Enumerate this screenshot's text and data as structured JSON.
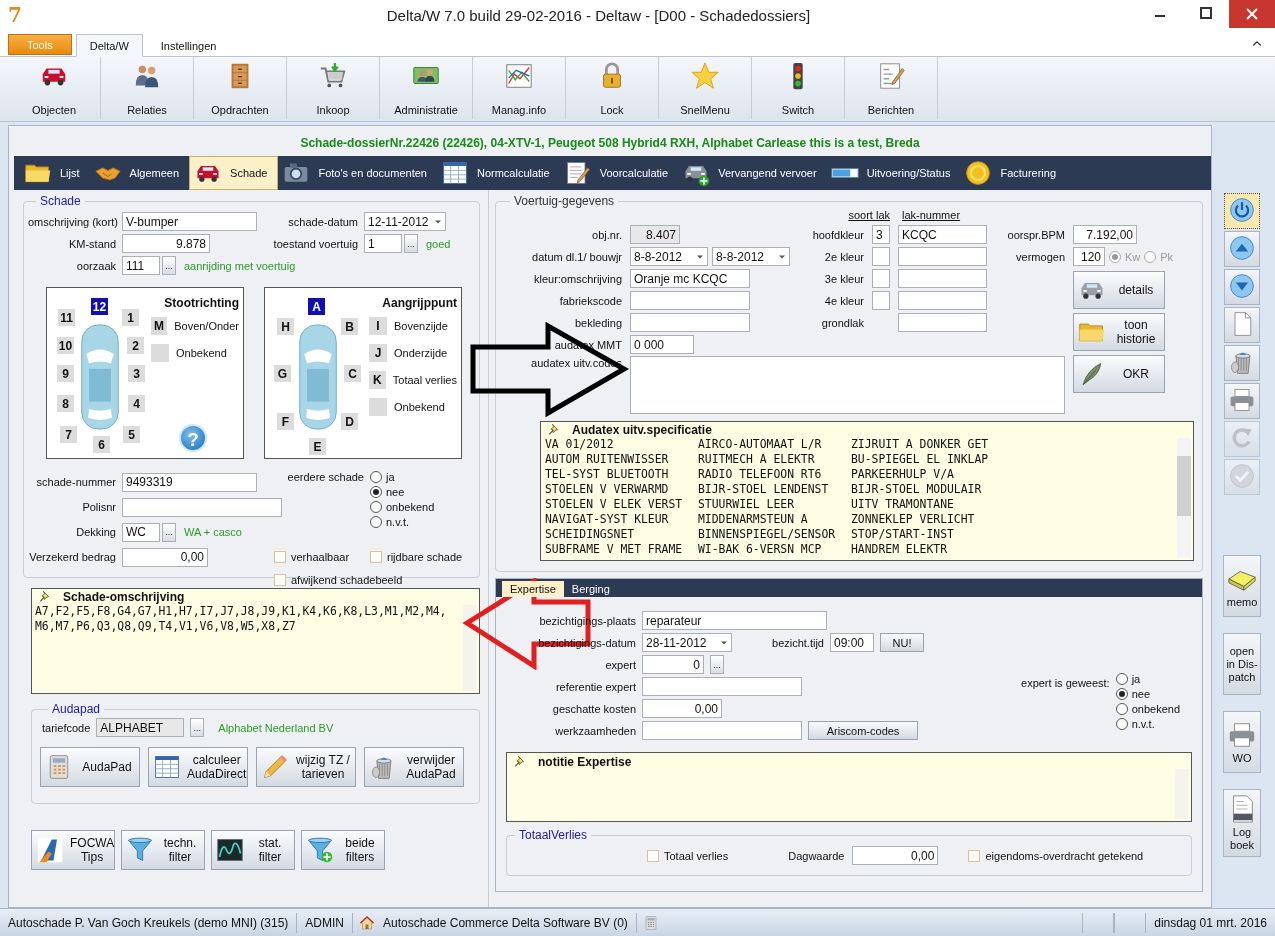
{
  "window": {
    "app_icon": "7",
    "title": "Delta/W 7.0 build 29-02-2016 - Deltaw - [D00 - Schadedossiers]"
  },
  "ribbon_tabs": [
    {
      "label": "Tools",
      "kind": "menu",
      "selected": false
    },
    {
      "label": "Delta/W",
      "kind": "tab",
      "selected": true
    },
    {
      "label": "Instellingen",
      "kind": "tab",
      "selected": false
    }
  ],
  "ribbon": [
    "Objecten",
    "Relaties",
    "Opdrachten",
    "Inkoop",
    "Administratie",
    "Manag.info",
    "Lock",
    "SnelMenu",
    "Switch",
    "Berichten"
  ],
  "dossier_header": "Schade-dossierNr.22426 (22426), 04-XTV-1, Peugeot 508 Hybrid4 RXH, Alphabet Carlease this is a test, Breda",
  "tabs": [
    {
      "label": "Lijst",
      "selected": false
    },
    {
      "label": "Algemeen",
      "selected": false
    },
    {
      "label": "Schade",
      "selected": true
    },
    {
      "label": "Foto's en documenten",
      "selected": false
    },
    {
      "label": "Normcalculatie",
      "selected": false
    },
    {
      "label": "Voorcalculatie",
      "selected": false
    },
    {
      "label": "Vervangend vervoer",
      "selected": false
    },
    {
      "label": "Uitvoering/Status",
      "selected": false
    },
    {
      "label": "Facturering",
      "selected": false
    }
  ],
  "schade": {
    "title": "Schade",
    "omschrijving": {
      "label": "omschrijving (kort)",
      "value": "V-bumper"
    },
    "schade_datum": {
      "label": "schade-datum",
      "value": "12-11-2012"
    },
    "km_stand": {
      "label": "KM-stand",
      "value": "9.878"
    },
    "toestand": {
      "label": "toestand voertuig",
      "value": "1",
      "browse_button": "...",
      "description": "goed"
    },
    "oorzaak": {
      "label": "oorzaak",
      "value": "111",
      "browse_button": "...",
      "description": "aanrijding met voertuig"
    },
    "stootrichting": {
      "title": "Stootrichting",
      "help_icon": "?",
      "positions": [
        {
          "label": "12",
          "selected": true
        },
        {
          "label": "11",
          "selected": false
        },
        {
          "label": "1",
          "selected": false
        },
        {
          "label": "10",
          "selected": false
        },
        {
          "label": "2",
          "selected": false
        },
        {
          "label": "9",
          "selected": false
        },
        {
          "label": "3",
          "selected": false
        },
        {
          "label": "8",
          "selected": false
        },
        {
          "label": "4",
          "selected": false
        },
        {
          "label": "7",
          "selected": false
        },
        {
          "label": "5",
          "selected": false
        },
        {
          "label": "6",
          "selected": false
        }
      ],
      "options": [
        {
          "key": "M",
          "label": "Boven/Onder",
          "selected": false
        },
        {
          "label": "Onbekend",
          "selected": false
        }
      ]
    },
    "aangrijppunt": {
      "title": "Aangrijppunt",
      "positions": [
        {
          "label": "A",
          "selected": true
        },
        {
          "label": "H",
          "selected": false
        },
        {
          "label": "B",
          "selected": false
        },
        {
          "label": "G",
          "selected": false
        },
        {
          "label": "C",
          "selected": false
        },
        {
          "label": "F",
          "selected": false
        },
        {
          "label": "D",
          "selected": false
        },
        {
          "label": "E",
          "selected": false
        }
      ],
      "options": [
        {
          "key": "I",
          "label": "Bovenzijde",
          "selected": false
        },
        {
          "key": "J",
          "label": "Onderzijde",
          "selected": false
        },
        {
          "key": "K",
          "label": "Totaal verlies",
          "selected": false
        },
        {
          "label": "Onbekend",
          "selected": false
        }
      ]
    },
    "schade_nummer": {
      "label": "schade-nummer",
      "value": "9493319"
    },
    "polisnr": {
      "label": "Polisnr"
    },
    "dekking": {
      "label": "Dekking",
      "value": "WC",
      "browse_button": "...",
      "description": "WA + casco"
    },
    "verzekerd_bedrag": {
      "label": "Verzekerd bedrag",
      "value": "0,00"
    },
    "eerdere_schade": {
      "label": "eerdere schade",
      "options": [
        {
          "label": "ja",
          "selected": false
        },
        {
          "label": "nee",
          "selected": true
        },
        {
          "label": "onbekend",
          "selected": false
        },
        {
          "label": "n.v.t.",
          "selected": false
        }
      ]
    },
    "checkboxes": [
      {
        "label": "verhaalbaar",
        "checked": false
      },
      {
        "label": "rijdbare schade",
        "checked": false
      },
      {
        "label": "afwijkend schadebeeld",
        "checked": false
      }
    ]
  },
  "schade_omschrijving": {
    "title": "Schade-omschrijving",
    "lines": [
      "A7,F2,F5,F8,G4,G7,H1,H7,I7,J7,J8,J9,K1,K4,K6,K8,L3,M1,M2,M4,",
      "M6,M7,P6,Q3,Q8,Q9,T4,V1,V6,V8,W5,X8,Z7"
    ]
  },
  "audapad": {
    "title": "Audapad",
    "tariefcode": {
      "label": "tariefcode",
      "value": "ALPHABET",
      "browse_button": "...",
      "description": "Alphabet Nederland BV"
    },
    "buttons": [
      {
        "lines": [
          "AudaPad"
        ]
      },
      {
        "lines": [
          "calculeer",
          "AudaDirect"
        ]
      },
      {
        "lines": [
          "wijzig TZ /",
          "tarieven"
        ]
      },
      {
        "lines": [
          "verwijder",
          "AudaPad"
        ]
      }
    ]
  },
  "filter_buttons": [
    {
      "lines": [
        "FOCWA",
        "Tips"
      ]
    },
    {
      "lines": [
        "techn.",
        "filter"
      ]
    },
    {
      "lines": [
        "stat.",
        "filter"
      ]
    },
    {
      "lines": [
        "beide",
        "filters"
      ]
    }
  ],
  "voertuig": {
    "title": "Voertuig-gegevens",
    "soort_lak_header": "soort lak",
    "lak_nummer_header": "lak-nummer",
    "obj_nr": {
      "label": "obj.nr.",
      "value": "8.407"
    },
    "datum": {
      "label": "datum dl.1/ bouwjr",
      "value": "8-8-2012",
      "value_2": "8-8-2012"
    },
    "kleur_omschrijving": {
      "label": "kleur:omschrijving",
      "value": "Oranje mc KCQC"
    },
    "fabriekscode": {
      "label": "fabriekscode"
    },
    "bekleding": {
      "label": "bekleding"
    },
    "audatex_mmt": {
      "label": "audatex MMT",
      "value": "0 000"
    },
    "audatex_uitv_codes": {
      "label": "audatex uitv.codes"
    },
    "kleuren": [
      {
        "kind": "kleur",
        "label": "hoofdkleur",
        "soort_lak": "3",
        "lak_nummer": "KCQC"
      },
      {
        "kind": "kleur",
        "label": "2e kleur"
      },
      {
        "kind": "kleur",
        "label": "3e kleur"
      },
      {
        "kind": "kleur",
        "label": "4e kleur"
      },
      {
        "kind": "lak",
        "label": "grondlak"
      }
    ],
    "oorspr_bpm": {
      "label": "oorspr.BPM",
      "value": "7.192,00"
    },
    "vermogen": {
      "label": "vermogen",
      "value": "120",
      "units": [
        {
          "label": "Kw",
          "selected": true
        },
        {
          "label": "Pk",
          "selected": false
        }
      ]
    },
    "buttons": [
      {
        "lines": [
          "details"
        ]
      },
      {
        "lines": [
          "toon",
          "historie"
        ]
      },
      {
        "lines": [
          "OKR"
        ]
      }
    ]
  },
  "audatex_spec": {
    "title": "Audatex uitv.specificatie",
    "rows": [
      [
        "VA 01/2012",
        "AIRCO-AUTOMAAT L/R",
        "ZIJRUIT A DONKER GET"
      ],
      [
        "AUTOM RUITENWISSER",
        "RUITMECH A ELEKTR",
        "BU-SPIEGEL EL INKLAP"
      ],
      [
        "TEL-SYST BLUETOOTH",
        "RADIO TELEFOON RT6",
        "PARKEERHULP V/A"
      ],
      [
        "STOELEN V VERWARMD",
        "BIJR-STOEL LENDENST",
        "BIJR-STOEL MODULAIR"
      ],
      [
        "STOELEN V ELEK VERST",
        "STUURWIEL LEER",
        "UITV TRAMONTANE"
      ],
      [
        "NAVIGAT-SYST KLEUR",
        "MIDDENARMSTEUN A",
        "ZONNEKLEP VERLICHT"
      ],
      [
        "SCHEIDINGSNET",
        "BINNENSPIEGEL/SENSOR",
        "STOP/START-INST"
      ],
      [
        "SUBFRAME V MET FRAME",
        "WI-BAK 6-VERSN MCP",
        "HANDREM ELEKTR"
      ]
    ]
  },
  "sub_tabs": [
    {
      "label": "Expertise",
      "selected": true
    },
    {
      "label": "Berging",
      "selected": false
    }
  ],
  "expertise": {
    "plaats": {
      "label": "bezichtigings-plaats",
      "value": "reparateur"
    },
    "datum": {
      "label": "bezichtigings-datum",
      "value": "28-11-2012"
    },
    "tijd": {
      "label": "bezicht.tijd",
      "value": "09:00"
    },
    "nu_button": "NU!",
    "expert": {
      "label": "expert",
      "value": "0",
      "browse_button": "..."
    },
    "referentie": {
      "label": "referentie expert"
    },
    "kosten": {
      "label": "geschatte kosten",
      "value": "0,00"
    },
    "werkzaamheden": {
      "label": "werkzaamheden"
    },
    "ariscom_button": "Ariscom-codes",
    "geweest": {
      "label": "expert is geweest:",
      "options": [
        {
          "label": "ja",
          "selected": false
        },
        {
          "label": "nee",
          "selected": true
        },
        {
          "label": "onbekend",
          "selected": false
        },
        {
          "label": "n.v.t.",
          "selected": false
        }
      ]
    }
  },
  "notitie_expertise": {
    "title": "notitie Expertise"
  },
  "totaal_verlies": {
    "title": "TotaalVerlies",
    "totaal": {
      "label": "Totaal verlies",
      "checked": false
    },
    "dagwaarde": {
      "label": "Dagwaarde",
      "value": "0,00"
    },
    "overdracht": {
      "label": "eigendoms-overdracht getekend",
      "checked": false
    }
  },
  "side_tools": [
    {
      "selected": true,
      "disabled": false
    },
    {
      "selected": false,
      "disabled": false
    },
    {
      "selected": false,
      "disabled": false
    },
    {
      "selected": false,
      "disabled": false
    },
    {
      "selected": false,
      "disabled": false
    },
    {
      "selected": false,
      "disabled": false
    },
    {
      "selected": false,
      "disabled": true
    },
    {
      "selected": false,
      "disabled": true
    }
  ],
  "side_buttons": [
    {
      "lines": [
        "memo"
      ]
    },
    {
      "lines": [
        "open",
        "in Dis-",
        "patch"
      ]
    },
    {
      "lines": [
        "WO"
      ]
    },
    {
      "lines": [
        "Log",
        "boek"
      ]
    }
  ],
  "status_bar": {
    "user": "Autoschade P. Van Goch Kreukels (demo MNI) (315)",
    "role": "ADMIN",
    "company": "Autoschade Commerce Delta Software BV (0)",
    "date": "dinsdag 01 mrt. 2016"
  }
}
